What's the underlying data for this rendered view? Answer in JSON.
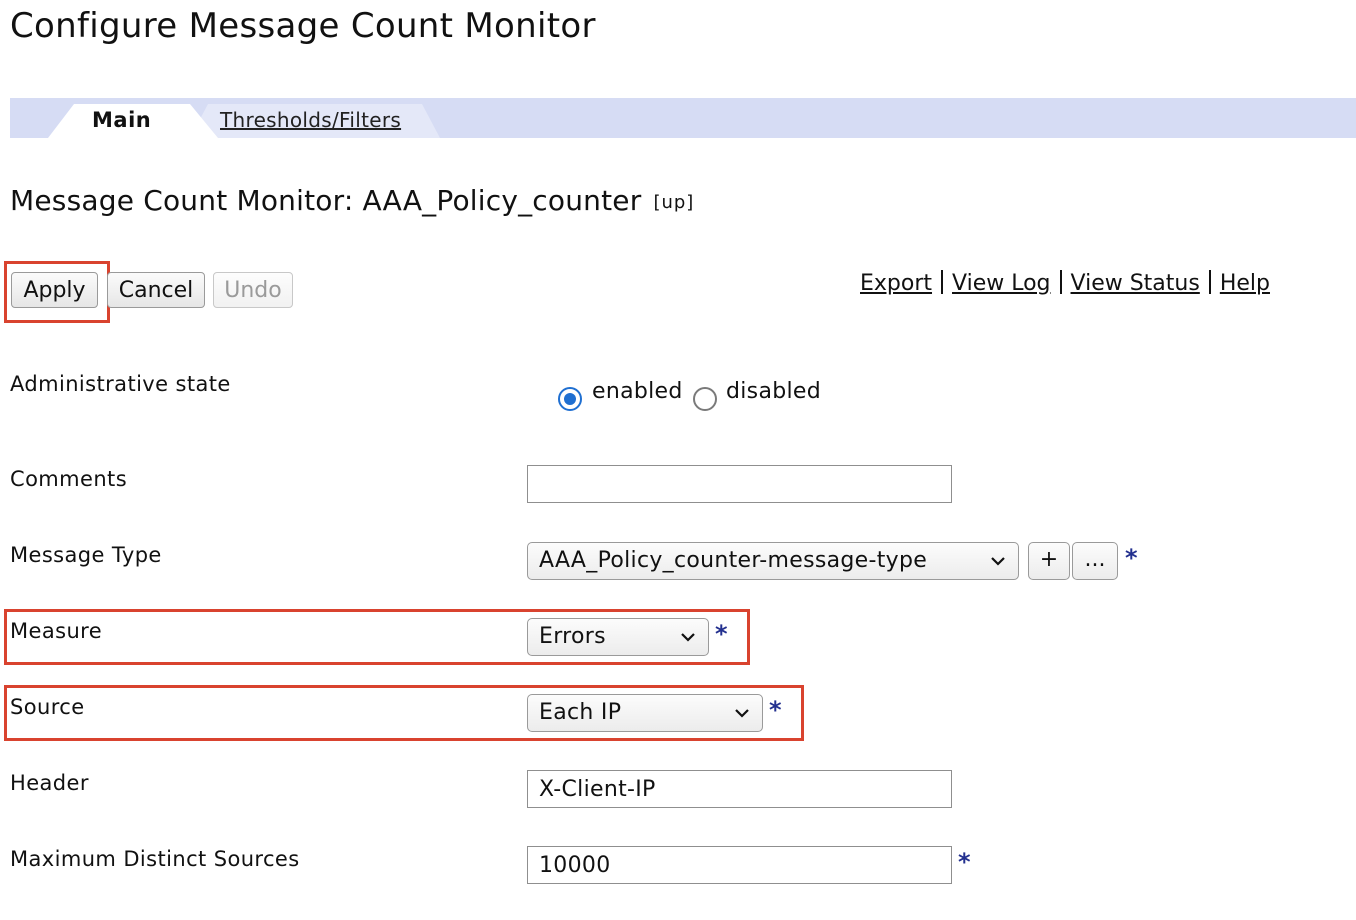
{
  "page": {
    "title": "Configure Message Count Monitor"
  },
  "tabs": {
    "main": "Main",
    "thresholds": "Thresholds/Filters"
  },
  "object": {
    "title": "Message Count Monitor: AAA_Policy_counter",
    "state": "[up]"
  },
  "buttons": {
    "apply": "Apply",
    "cancel": "Cancel",
    "undo": "Undo"
  },
  "links": {
    "export": "Export",
    "view_log": "View Log",
    "view_status": "View Status",
    "help": "Help"
  },
  "fields": {
    "admin_state": {
      "label": "Administrative state",
      "options": [
        "enabled",
        "disabled"
      ],
      "selected": "enabled"
    },
    "comments": {
      "label": "Comments",
      "value": ""
    },
    "message_type": {
      "label": "Message Type",
      "value": "AAA_Policy_counter-message-type",
      "add": "+",
      "more": "...",
      "required": "*"
    },
    "measure": {
      "label": "Measure",
      "value": "Errors",
      "required": "*"
    },
    "source": {
      "label": "Source",
      "value": "Each IP",
      "required": "*"
    },
    "header": {
      "label": "Header",
      "value": "X-Client-IP"
    },
    "max_sources": {
      "label": "Maximum Distinct Sources",
      "value": "10000",
      "required": "*"
    }
  },
  "colors": {
    "highlight": "#d9432f",
    "tab_strip": "#d6dcf4",
    "radio_selected": "#1f6fd1",
    "required_marker": "#23308f"
  },
  "icons": {
    "select_arrow": "chevron-down-icon",
    "radio": "radio-icon"
  }
}
